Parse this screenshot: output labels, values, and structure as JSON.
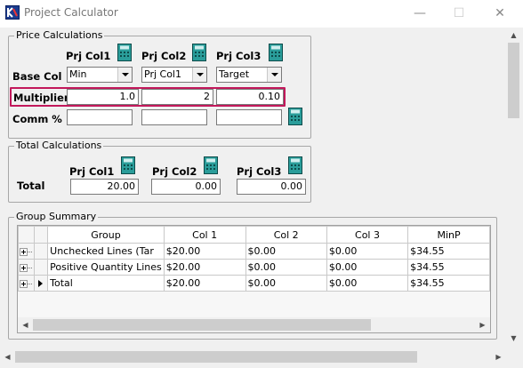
{
  "window": {
    "title": "Project Calculator",
    "minimize_glyph": "—",
    "maximize_glyph": "☐",
    "close_glyph": "✕"
  },
  "price_calc": {
    "legend": "Price Calculations",
    "columns": [
      "Prj Col1",
      "Prj Col2",
      "Prj Col3"
    ],
    "base_col_label": "Base Col",
    "base_col_values": [
      "Min",
      "Prj Col1",
      "Target"
    ],
    "multiplier_label": "Multiplier",
    "multiplier_values": [
      "1.0",
      "2",
      "0.10"
    ],
    "comm_label": "Comm %",
    "comm_values": [
      "",
      "",
      ""
    ]
  },
  "total_calc": {
    "legend": "Total Calculations",
    "columns": [
      "Prj Col1",
      "Prj Col2",
      "Prj Col3"
    ],
    "total_label": "Total",
    "total_values": [
      "20.00",
      "0.00",
      "0.00"
    ]
  },
  "group_summary": {
    "legend": "Group Summary",
    "headers": [
      "Group",
      "Col 1",
      "Col 2",
      "Col 3",
      "MinP"
    ],
    "rows": [
      [
        "Unchecked Lines (Tar",
        "$20.00",
        "$0.00",
        "$0.00",
        "$34.55"
      ],
      [
        "Positive Quantity Lines",
        "$20.00",
        "$0.00",
        "$0.00",
        "$34.55"
      ],
      [
        "Total",
        "$20.00",
        "$0.00",
        "$0.00",
        "$34.55"
      ]
    ]
  },
  "icons": {
    "app": "project-calculator-app-icon",
    "calc": "calculator-icon"
  },
  "colors": {
    "highlight": "#c2185b",
    "calc_icon": "#2a9d9a"
  }
}
